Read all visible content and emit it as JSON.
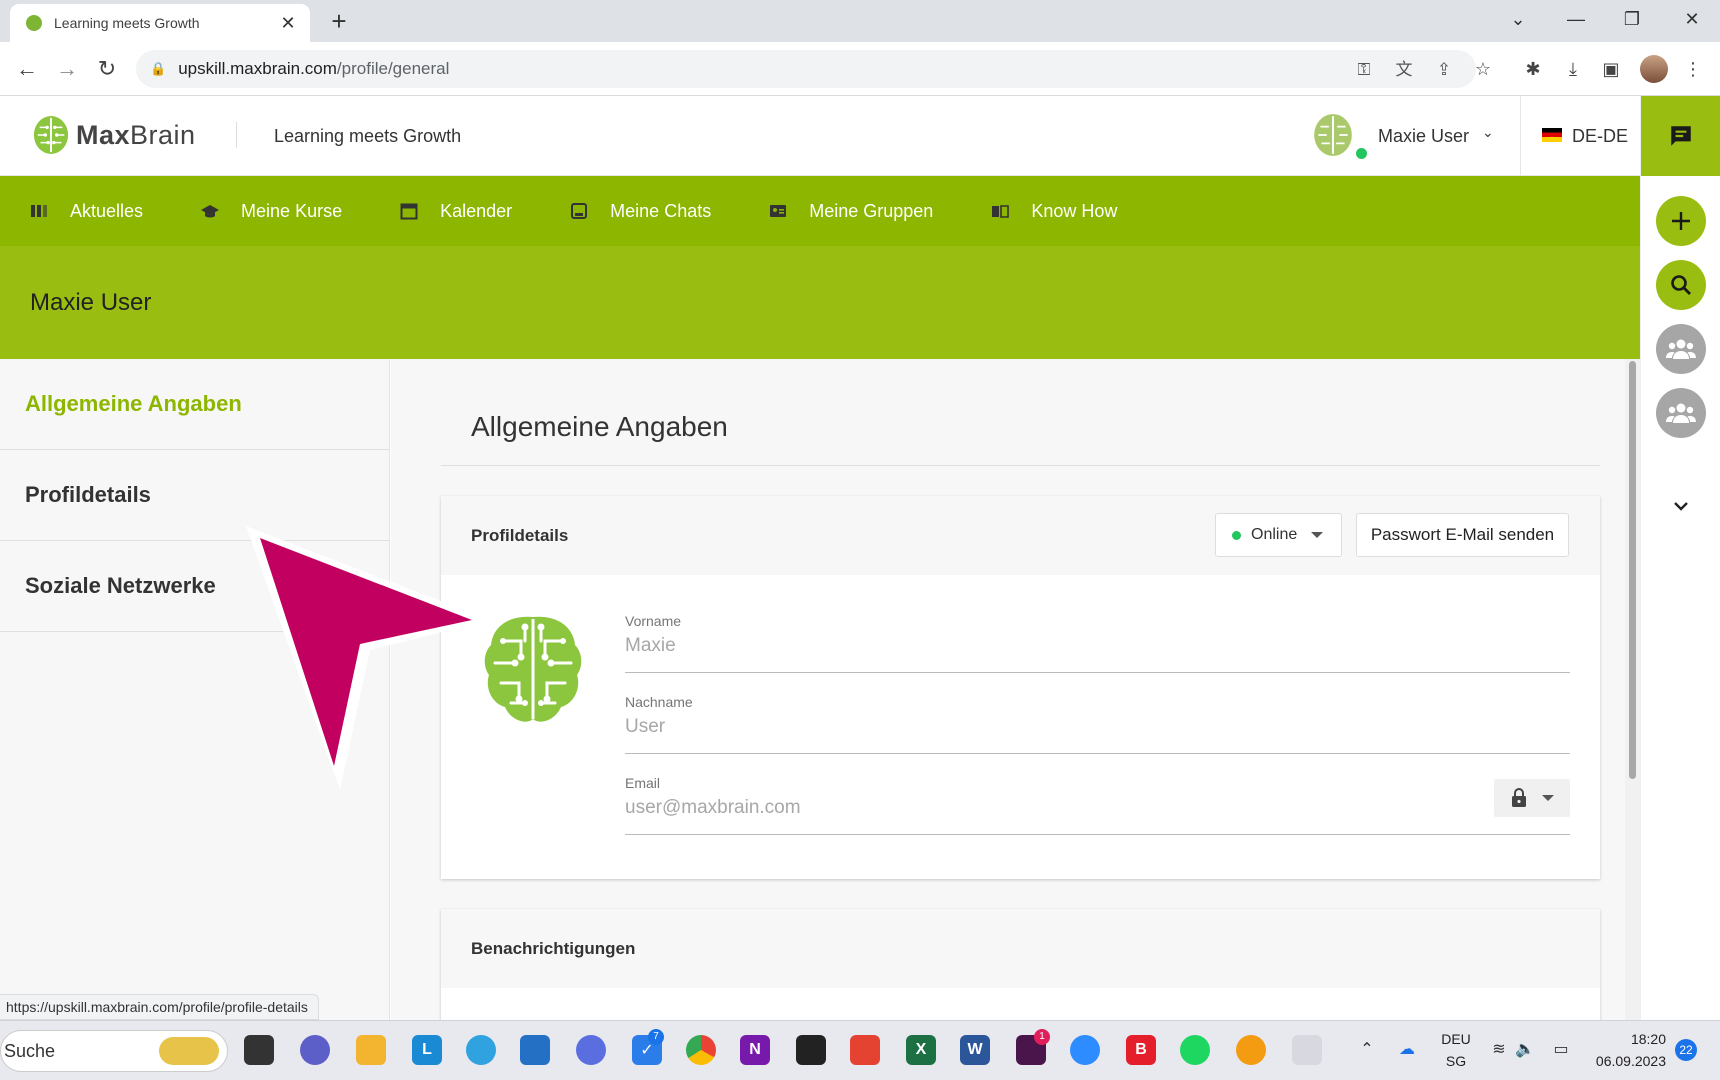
{
  "browser": {
    "tab_title": "Learning meets Growth",
    "url_host": "upskill.maxbrain.com",
    "url_path": "/profile/general",
    "status_url": "https://upskill.maxbrain.com/profile/profile-details"
  },
  "header": {
    "logo_bold": "Max",
    "logo_light": "Brain",
    "tagline": "Learning meets Growth",
    "user_name": "Maxie User",
    "language": "DE-DE"
  },
  "nav": {
    "items": [
      {
        "label": "Aktuelles",
        "icon": "news-icon"
      },
      {
        "label": "Meine Kurse",
        "icon": "graduation-cap-icon"
      },
      {
        "label": "Kalender",
        "icon": "calendar-icon"
      },
      {
        "label": "Meine Chats",
        "icon": "chat-icon"
      },
      {
        "label": "Meine Gruppen",
        "icon": "group-icon"
      },
      {
        "label": "Know How",
        "icon": "book-icon"
      }
    ]
  },
  "banner": {
    "title": "Maxie User"
  },
  "sidebar": {
    "items": [
      {
        "label": "Allgemeine Angaben",
        "active": true
      },
      {
        "label": "Profildetails",
        "active": false
      },
      {
        "label": "Soziale Netzwerke",
        "active": false
      }
    ]
  },
  "main": {
    "title": "Allgemeine Angaben",
    "card": {
      "title": "Profildetails",
      "status": "Online",
      "password_button": "Passwort E-Mail senden",
      "fields": [
        {
          "label": "Vorname",
          "value": "Maxie"
        },
        {
          "label": "Nachname",
          "value": "User"
        },
        {
          "label": "Email",
          "value": "user@maxbrain.com"
        }
      ]
    },
    "card2": {
      "title": "Benachrichtigungen"
    }
  },
  "taskbar": {
    "search": "Suche",
    "lang_top": "DEU",
    "lang_bottom": "SG",
    "time": "18:20",
    "date": "06.09.2023",
    "notification_count": "22",
    "todo_badge": "7",
    "slack_badge": "1"
  },
  "colors": {
    "brand_green": "#99bd10",
    "nav_green": "#8db600",
    "pointer_magenta": "#c2005f",
    "online_green": "#22c55e"
  }
}
